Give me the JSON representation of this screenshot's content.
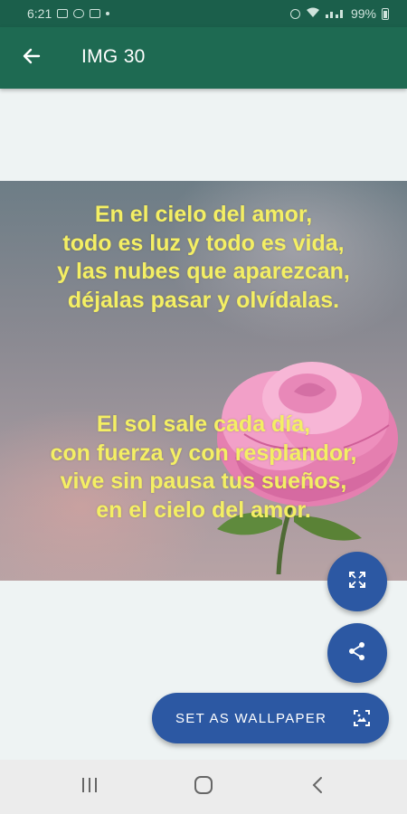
{
  "status_bar": {
    "time": "6:21",
    "battery": "99%"
  },
  "app_bar": {
    "title": "IMG 30",
    "back_icon": "arrow-back-icon"
  },
  "image": {
    "verse1": [
      "En el cielo del amor,",
      "todo es luz y todo es vida,",
      "y las nubes que aparezcan,",
      "déjalas pasar y olvídalas."
    ],
    "verse2": [
      "El sol sale cada día,",
      "con fuerza y con resplandor,",
      "vive sin pausa tus sueños,",
      "en el cielo del amor."
    ],
    "text_color": "#f4ef64",
    "decoration": "pink-rose"
  },
  "actions": {
    "fullscreen_icon": "fullscreen-icon",
    "share_icon": "share-icon",
    "wallpaper_label": "SET AS WALLPAPER",
    "wallpaper_icon": "wallpaper-icon",
    "accent_color": "#2c58a3"
  },
  "nav_bar": {
    "recents_icon": "recents-icon",
    "home_icon": "home-icon",
    "back_icon": "nav-back-icon"
  }
}
